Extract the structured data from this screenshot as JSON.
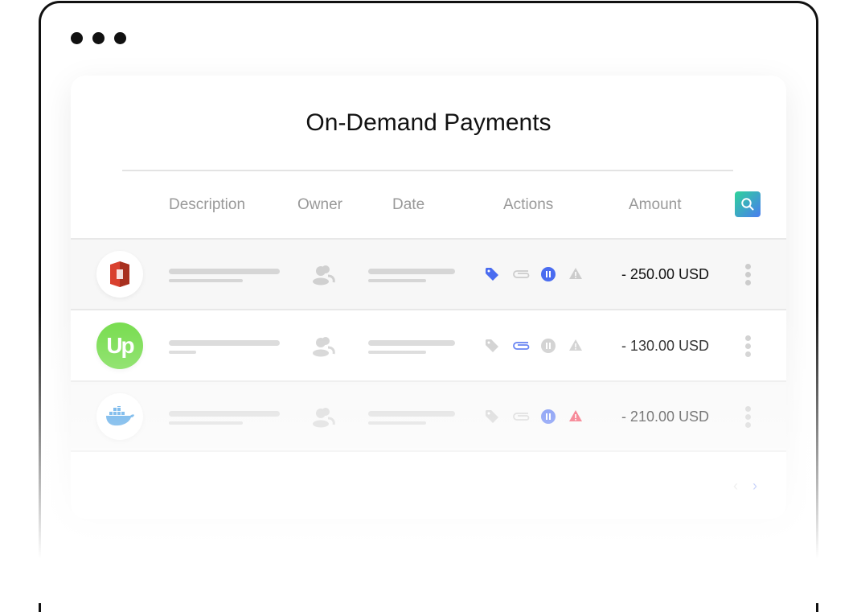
{
  "window": {
    "controls": [
      "dot",
      "dot",
      "dot"
    ]
  },
  "title": "On-Demand Payments",
  "columns": [
    "Description",
    "Owner",
    "Date",
    "Actions",
    "Amount"
  ],
  "search_icon": "search-icon",
  "colors": {
    "accent": "#4a6cf0",
    "danger": "#f0304a",
    "inactive": "#cccccc"
  },
  "rows": [
    {
      "logo": "aws-s3-logo",
      "amount": "- 250.00 USD",
      "actions": {
        "tag": true,
        "attach": false,
        "pause": true,
        "warning": "inactive"
      }
    },
    {
      "logo": "upwork-logo",
      "amount": "- 130.00 USD",
      "actions": {
        "tag": false,
        "attach": true,
        "pause": false,
        "warning": "inactive"
      }
    },
    {
      "logo": "docker-logo",
      "amount": "- 210.00 USD",
      "actions": {
        "tag": false,
        "attach": false,
        "pause": true,
        "warning": "alert"
      }
    }
  ],
  "pagination": {
    "prev": "‹",
    "next": "›"
  }
}
